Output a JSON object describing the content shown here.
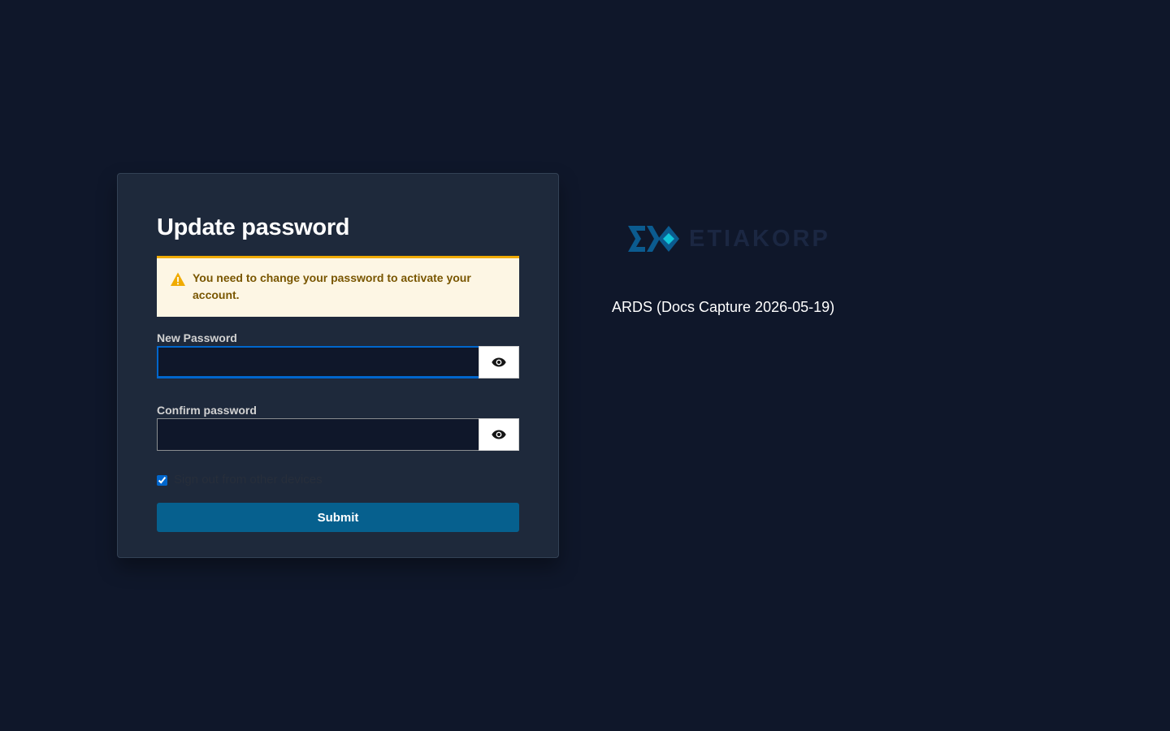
{
  "form": {
    "title": "Update password",
    "alert": {
      "icon": "warning-triangle-icon",
      "message": "You need to change your password to activate your account."
    },
    "new_password": {
      "label": "New Password",
      "value": "",
      "toggle_icon": "eye-icon"
    },
    "confirm_password": {
      "label": "Confirm password",
      "value": "",
      "toggle_icon": "eye-icon"
    },
    "sign_out_other_devices": {
      "label": "Sign out from other devices",
      "checked": true
    },
    "submit_label": "Submit"
  },
  "brand": {
    "logo_icon": "etiakorp-logo-icon",
    "wordmark": "ETIAKORP"
  },
  "app_name": "ARDS (Docs Capture 2026-05-19)",
  "colors": {
    "background": "#0f172a",
    "card": "#1e293b",
    "primary": "#06608e",
    "warning": "#f0ab00",
    "alert_bg": "#fdf6e4"
  }
}
